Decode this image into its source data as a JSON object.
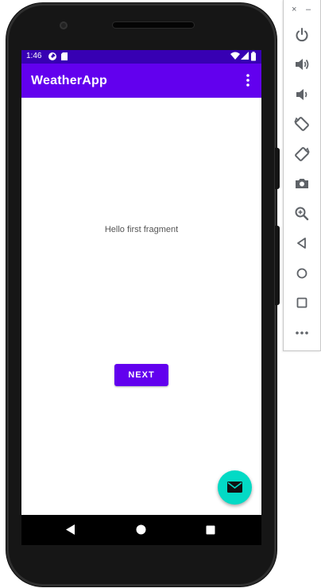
{
  "status_bar": {
    "time": "1:46"
  },
  "app_bar": {
    "title": "WeatherApp"
  },
  "content": {
    "message": "Hello first fragment",
    "next_label": "NEXT"
  },
  "toolbar": {
    "close_glyph": "×",
    "minimize_glyph": "–"
  },
  "colors": {
    "status_bar": "#3700b3",
    "primary": "#6200ee",
    "fab": "#03dac5",
    "nav_bar": "#000000"
  },
  "icons": {
    "status_left": [
      "data-saver-icon",
      "sd-card-icon"
    ],
    "status_right": [
      "wifi-icon",
      "signal-icon",
      "battery-icon"
    ],
    "nav": [
      "back-icon",
      "home-icon",
      "recents-icon"
    ],
    "fab": "email-icon",
    "toolbar": [
      "power-icon",
      "volume-up-icon",
      "volume-down-icon",
      "rotate-left-icon",
      "rotate-right-icon",
      "camera-icon",
      "zoom-icon",
      "back-icon",
      "home-icon",
      "overview-icon",
      "more-icon"
    ]
  }
}
